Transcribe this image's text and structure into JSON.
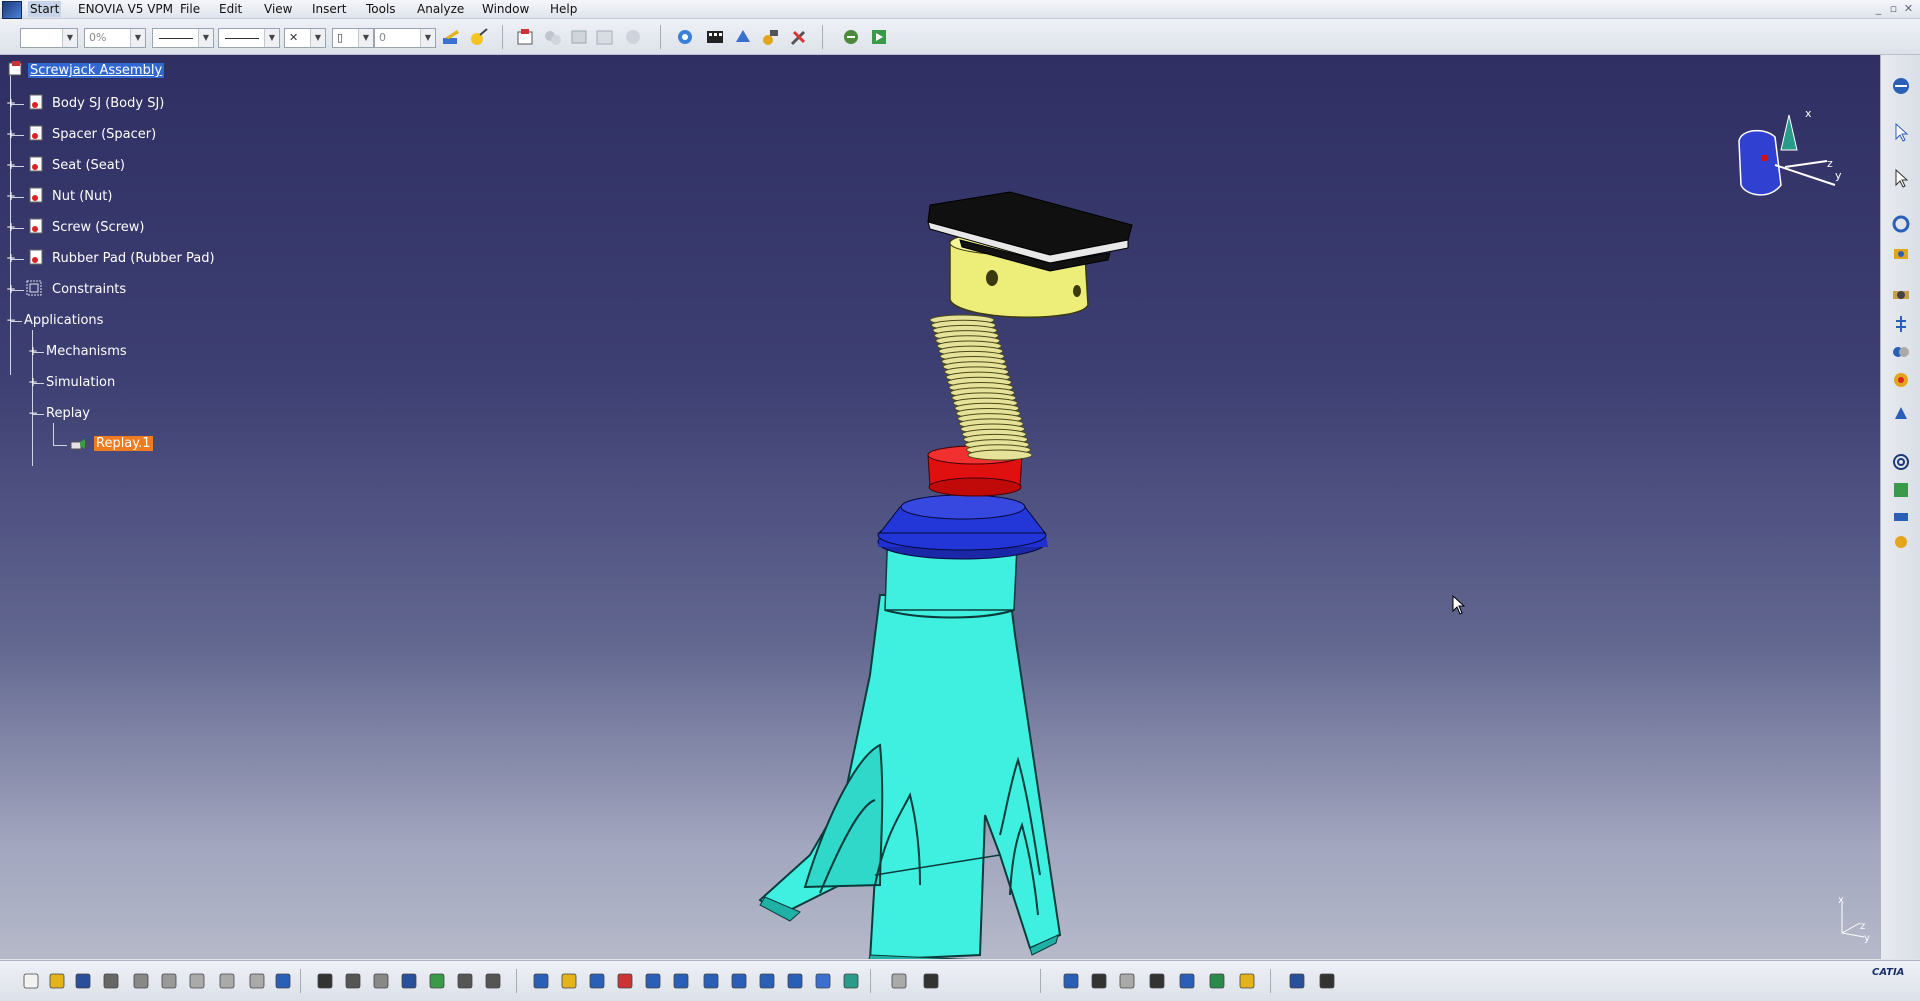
{
  "menubar": {
    "items": [
      "Start",
      "ENOVIA V5 VPM",
      "File",
      "Edit",
      "View",
      "Insert",
      "Tools",
      "Analyze",
      "Window",
      "Help"
    ],
    "window_buttons": [
      "_",
      "▫",
      "✕"
    ]
  },
  "toolbar": {
    "color_value": "",
    "transparency_value": "0%",
    "layer_value": "0"
  },
  "tree": {
    "root": "Screwjack Assembly",
    "parts": [
      "Body SJ (Body SJ)",
      "Spacer (Spacer)",
      "Seat (Seat)",
      "Nut (Nut)",
      "Screw (Screw)",
      "Rubber Pad (Rubber Pad)"
    ],
    "constraints": "Constraints",
    "applications": "Applications",
    "mechanisms": "Mechanisms",
    "simulation": "Simulation",
    "replay": "Replay",
    "replay_item": "Replay.1"
  },
  "compass": {
    "x": "x",
    "y": "y",
    "z": "z"
  },
  "axis_triad": {
    "x": "x",
    "y": "y",
    "z": "z"
  },
  "brand": {
    "name": "CATIA"
  },
  "colors": {
    "viewport_top": "#2f2f63",
    "viewport_bottom": "#b5b9c9",
    "body": "#3ff0e0",
    "nut_blue": "#1f2fd0",
    "collar_red": "#e01010",
    "screw_thread": "#e6e29a",
    "seat_yellow": "#efef7a",
    "pad_black": "#101010",
    "selection": "#3168d0",
    "highlight": "#f07a1e"
  }
}
